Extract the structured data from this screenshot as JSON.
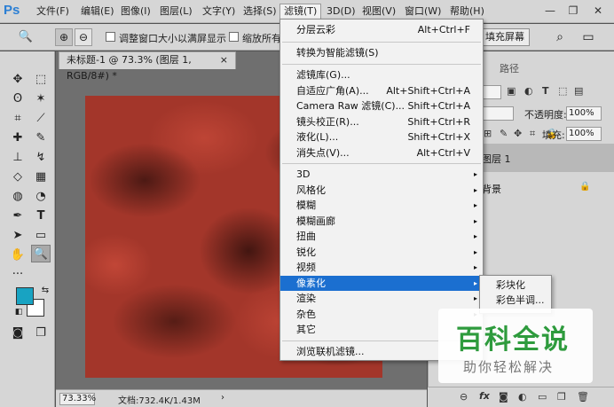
{
  "app": {
    "logo": "Ps"
  },
  "menubar": {
    "items": [
      {
        "label": "文件(F)"
      },
      {
        "label": "编辑(E)"
      },
      {
        "label": "图像(I)"
      },
      {
        "label": "图层(L)"
      },
      {
        "label": "文字(Y)"
      },
      {
        "label": "选择(S)"
      },
      {
        "label": "滤镜(T)"
      },
      {
        "label": "3D(D)"
      },
      {
        "label": "视图(V)"
      },
      {
        "label": "窗口(W)"
      },
      {
        "label": "帮助(H)"
      }
    ],
    "window_controls": {
      "minimize": "—",
      "restore": "❐",
      "close": "✕"
    }
  },
  "options_bar": {
    "resize_window_label": "调整窗口大小以满屏显示",
    "zoom_all_label": "缩放所有",
    "fill_screen_label": "填充屏幕"
  },
  "document": {
    "tab_title": "未标题-1 @ 73.3% (图层 1, RGB/8#) *",
    "tab_close": "×",
    "zoom_value": "73.33%",
    "doc_info": "文档:732.4K/1.43M",
    "status_arrow": "›"
  },
  "right_panel": {
    "tab_paths": "路径",
    "opacity_label": "不透明度:",
    "opacity_value": "100%",
    "fill_label": "填充:",
    "fill_value": "100%",
    "layers": [
      {
        "name": "图层 1"
      },
      {
        "name": "背景"
      }
    ]
  },
  "filter_menu": {
    "items": [
      {
        "label": "分层云彩",
        "shortcut": "Alt+Ctrl+F"
      },
      {
        "label": "转换为智能滤镜(S)",
        "shortcut": ""
      },
      {
        "label": "滤镜库(G)...",
        "shortcut": ""
      },
      {
        "label": "自适应广角(A)...",
        "shortcut": "Alt+Shift+Ctrl+A"
      },
      {
        "label": "Camera Raw 滤镜(C)...",
        "shortcut": "Shift+Ctrl+A"
      },
      {
        "label": "镜头校正(R)...",
        "shortcut": "Shift+Ctrl+R"
      },
      {
        "label": "液化(L)...",
        "shortcut": "Shift+Ctrl+X"
      },
      {
        "label": "消失点(V)...",
        "shortcut": "Alt+Ctrl+V"
      },
      {
        "label": "3D"
      },
      {
        "label": "风格化"
      },
      {
        "label": "模糊"
      },
      {
        "label": "模糊画廊"
      },
      {
        "label": "扭曲"
      },
      {
        "label": "锐化"
      },
      {
        "label": "视频"
      },
      {
        "label": "像素化"
      },
      {
        "label": "渲染"
      },
      {
        "label": "杂色"
      },
      {
        "label": "其它"
      },
      {
        "label": "浏览联机滤镜..."
      }
    ],
    "submenu_arrow": "▸"
  },
  "pixelate_submenu": {
    "items": [
      {
        "label": "彩块化"
      },
      {
        "label": "彩色半调..."
      }
    ]
  },
  "watermark": {
    "title": "百科全说",
    "subtitle": "助你轻松解决"
  },
  "colors": {
    "foreground": "#18a3c2",
    "background": "#ffffff",
    "menu_highlight": "#1b6fd0"
  }
}
